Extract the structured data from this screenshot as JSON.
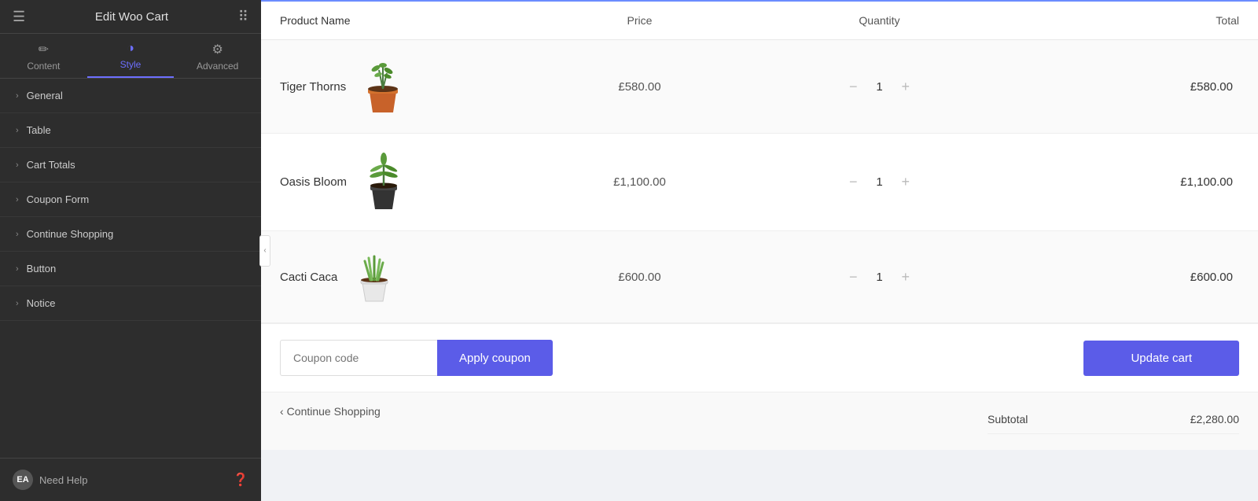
{
  "sidebar": {
    "title": "Edit Woo Cart",
    "tabs": [
      {
        "label": "Content",
        "icon": "✏️",
        "active": false
      },
      {
        "label": "Style",
        "icon": "◑",
        "active": true
      },
      {
        "label": "Advanced",
        "icon": "⚙️",
        "active": false
      }
    ],
    "menu_items": [
      {
        "label": "General"
      },
      {
        "label": "Table"
      },
      {
        "label": "Cart Totals"
      },
      {
        "label": "Coupon Form"
      },
      {
        "label": "Continue Shopping"
      },
      {
        "label": "Button"
      },
      {
        "label": "Notice"
      }
    ],
    "footer": {
      "badge": "EA",
      "need_help": "Need Help"
    }
  },
  "cart": {
    "header": {
      "product_name": "Product Name",
      "price": "Price",
      "quantity": "Quantity",
      "total": "Total"
    },
    "rows": [
      {
        "name": "Tiger Thorns",
        "price": "£580.00",
        "quantity": 1,
        "total": "£580.00"
      },
      {
        "name": "Oasis Bloom",
        "price": "£1,100.00",
        "quantity": 1,
        "total": "£1,100.00"
      },
      {
        "name": "Cacti Caca",
        "price": "£600.00",
        "quantity": 1,
        "total": "£600.00"
      }
    ],
    "coupon_placeholder": "Coupon code",
    "apply_coupon_label": "Apply coupon",
    "update_cart_label": "Update cart",
    "continue_shopping_label": "Continue Shopping",
    "subtotal_label": "Subtotal",
    "subtotal_value": "£2,280.00"
  }
}
